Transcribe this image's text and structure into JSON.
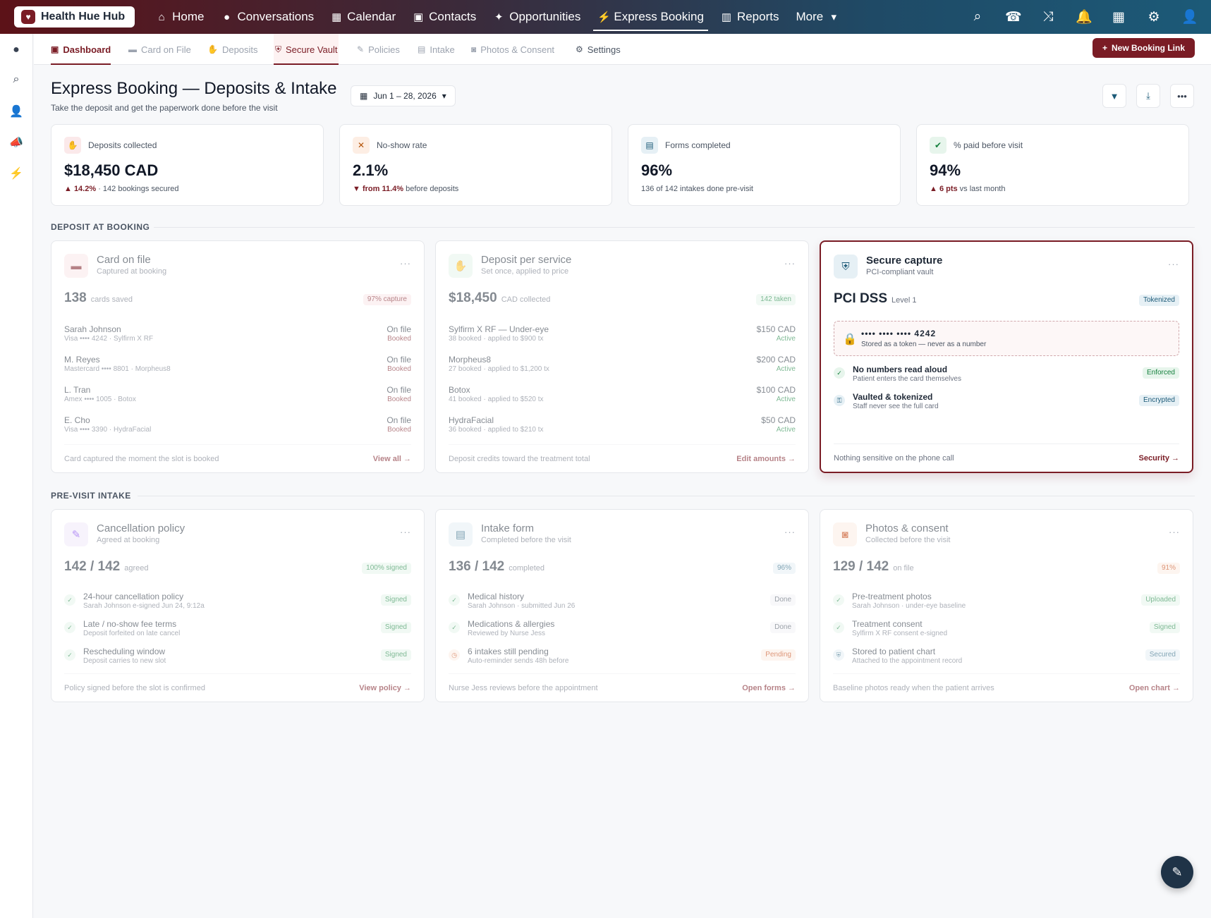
{
  "app": {
    "brand": "Health Hue Hub"
  },
  "nav": [
    {
      "label": "Home",
      "icon": "home-icon",
      "glyph": "⌂"
    },
    {
      "label": "Conversations",
      "icon": "chat-icon",
      "glyph": "💬"
    },
    {
      "label": "Calendar",
      "icon": "calendar-icon",
      "glyph": "▦"
    },
    {
      "label": "Contacts",
      "icon": "contact-card-icon",
      "glyph": "▣"
    },
    {
      "label": "Opportunities",
      "icon": "lightbulb-icon",
      "glyph": "💡"
    },
    {
      "label": "Express Booking",
      "icon": "bolt-icon",
      "glyph": "⚡"
    },
    {
      "label": "Reports",
      "icon": "bar-chart-icon",
      "glyph": "▥"
    },
    {
      "label": "More",
      "icon": "caret-down-icon",
      "glyph": "▾"
    }
  ],
  "subtabs": [
    {
      "label": "Dashboard",
      "icon": "dashboard-icon"
    },
    {
      "label": "Card on File",
      "icon": "card-icon"
    },
    {
      "label": "Deposits",
      "icon": "hand-coin-icon"
    },
    {
      "label": "Secure Vault",
      "icon": "shield-icon"
    },
    {
      "label": "Policies",
      "icon": "document-pen-icon"
    },
    {
      "label": "Intake",
      "icon": "clipboard-icon"
    },
    {
      "label": "Photos & Consent",
      "icon": "camera-icon"
    },
    {
      "label": "Settings",
      "icon": "gear-icon"
    }
  ],
  "actions": {
    "new_booking_link": "New Booking Link"
  },
  "header": {
    "title": "Express Booking — Deposits & Intake",
    "subtitle": "Take the deposit and get the paperwork done before the visit",
    "date_range": "Jun 1 – 28, 2026"
  },
  "kpis": [
    {
      "label": "Deposits collected",
      "value": "$18,450 CAD",
      "delta": "▲ 14.2%",
      "note": " · 142 bookings secured"
    },
    {
      "label": "No-show rate",
      "value": "2.1%",
      "delta": "▼ from 11.4%",
      "note": " before deposits"
    },
    {
      "label": "Forms completed",
      "value": "96%",
      "delta": "",
      "note": "136 of 142 intakes done pre-visit"
    },
    {
      "label": "% paid before visit",
      "value": "94%",
      "delta": "▲ 6 pts",
      "note": " vs last month"
    }
  ],
  "sections": {
    "deposit": "DEPOSIT AT BOOKING",
    "intake": "PRE-VISIT INTAKE"
  },
  "card_on_file": {
    "title": "Card on file",
    "subtitle": "Captured at booking",
    "big": "138",
    "big_unit": "cards saved",
    "pill": "97% capture",
    "rows": [
      {
        "name": "Sarah Johnson",
        "detail": "Visa •••• 4242 · Sylfirm X RF",
        "value": "On file",
        "status": "Booked"
      },
      {
        "name": "M. Reyes",
        "detail": "Mastercard •••• 8801 · Morpheus8",
        "value": "On file",
        "status": "Booked"
      },
      {
        "name": "L. Tran",
        "detail": "Amex •••• 1005 · Botox",
        "value": "On file",
        "status": "Booked"
      },
      {
        "name": "E. Cho",
        "detail": "Visa •••• 3390 · HydraFacial",
        "value": "On file",
        "status": "Booked"
      }
    ],
    "foot": "Card captured the moment the slot is booked",
    "link": "View all →"
  },
  "deposit_service": {
    "title": "Deposit per service",
    "subtitle": "Set once, applied to price",
    "big": "$18,450",
    "big_unit": "CAD collected",
    "pill": "142 taken",
    "rows": [
      {
        "name": "Sylfirm X RF — Under-eye",
        "detail": "38 booked · applied to $900 tx",
        "value": "$150 CAD",
        "status": "Active"
      },
      {
        "name": "Morpheus8",
        "detail": "27 booked · applied to $1,200 tx",
        "value": "$200 CAD",
        "status": "Active"
      },
      {
        "name": "Botox",
        "detail": "41 booked · applied to $520 tx",
        "value": "$100 CAD",
        "status": "Active"
      },
      {
        "name": "HydraFacial",
        "detail": "36 booked · applied to $210 tx",
        "value": "$50 CAD",
        "status": "Active"
      }
    ],
    "foot": "Deposit credits toward the treatment total",
    "link": "Edit amounts →"
  },
  "secure": {
    "title": "Secure capture",
    "subtitle": "PCI-compliant vault",
    "big": "PCI DSS",
    "big_unit": "Level 1",
    "pill": "Tokenized",
    "card_number": "•••• •••• •••• 4242",
    "token_note": "Stored as a token — never as a number",
    "rows": [
      {
        "name": "No numbers read aloud",
        "detail": "Patient enters the card themselves",
        "badge": "Enforced"
      },
      {
        "name": "Vaulted & tokenized",
        "detail": "Staff never see the full card",
        "badge": "Encrypted"
      }
    ],
    "foot": "Nothing sensitive on the phone call",
    "link": "Security →"
  },
  "cancellation": {
    "title": "Cancellation policy",
    "subtitle": "Agreed at booking",
    "big": "142 / 142",
    "big_unit": "agreed",
    "pill": "100% signed",
    "rows": [
      {
        "name": "24-hour cancellation policy",
        "detail": "Sarah Johnson e-signed Jun 24, 9:12a",
        "badge": "Signed"
      },
      {
        "name": "Late / no-show fee terms",
        "detail": "Deposit forfeited on late cancel",
        "badge": "Signed"
      },
      {
        "name": "Rescheduling window",
        "detail": "Deposit carries to new slot",
        "badge": "Signed"
      }
    ],
    "foot": "Policy signed before the slot is confirmed",
    "link": "View policy →"
  },
  "intake": {
    "title": "Intake form",
    "subtitle": "Completed before the visit",
    "big": "136 / 142",
    "big_unit": "completed",
    "pill": "96%",
    "rows": [
      {
        "name": "Medical history",
        "detail": "Sarah Johnson · submitted Jun 26",
        "badge": "Done"
      },
      {
        "name": "Medications & allergies",
        "detail": "Reviewed by Nurse Jess",
        "badge": "Done"
      },
      {
        "name": "6 intakes still pending",
        "detail": "Auto-reminder sends 48h before",
        "badge": "Pending"
      }
    ],
    "foot": "Nurse Jess reviews before the appointment",
    "link": "Open forms →"
  },
  "photos": {
    "title": "Photos & consent",
    "subtitle": "Collected before the visit",
    "big": "129 / 142",
    "big_unit": "on file",
    "pill": "91%",
    "rows": [
      {
        "name": "Pre-treatment photos",
        "detail": "Sarah Johnson · under-eye baseline",
        "badge": "Uploaded"
      },
      {
        "name": "Treatment consent",
        "detail": "Sylfirm X RF consent e-signed",
        "badge": "Signed"
      },
      {
        "name": "Stored to patient chart",
        "detail": "Attached to the appointment record",
        "badge": "Secured"
      }
    ],
    "foot": "Baseline photos ready when the patient arrives",
    "link": "Open chart →"
  },
  "colors": {
    "brand": "#7a1c25",
    "accent": "#1c5a78",
    "success": "#15803d"
  }
}
